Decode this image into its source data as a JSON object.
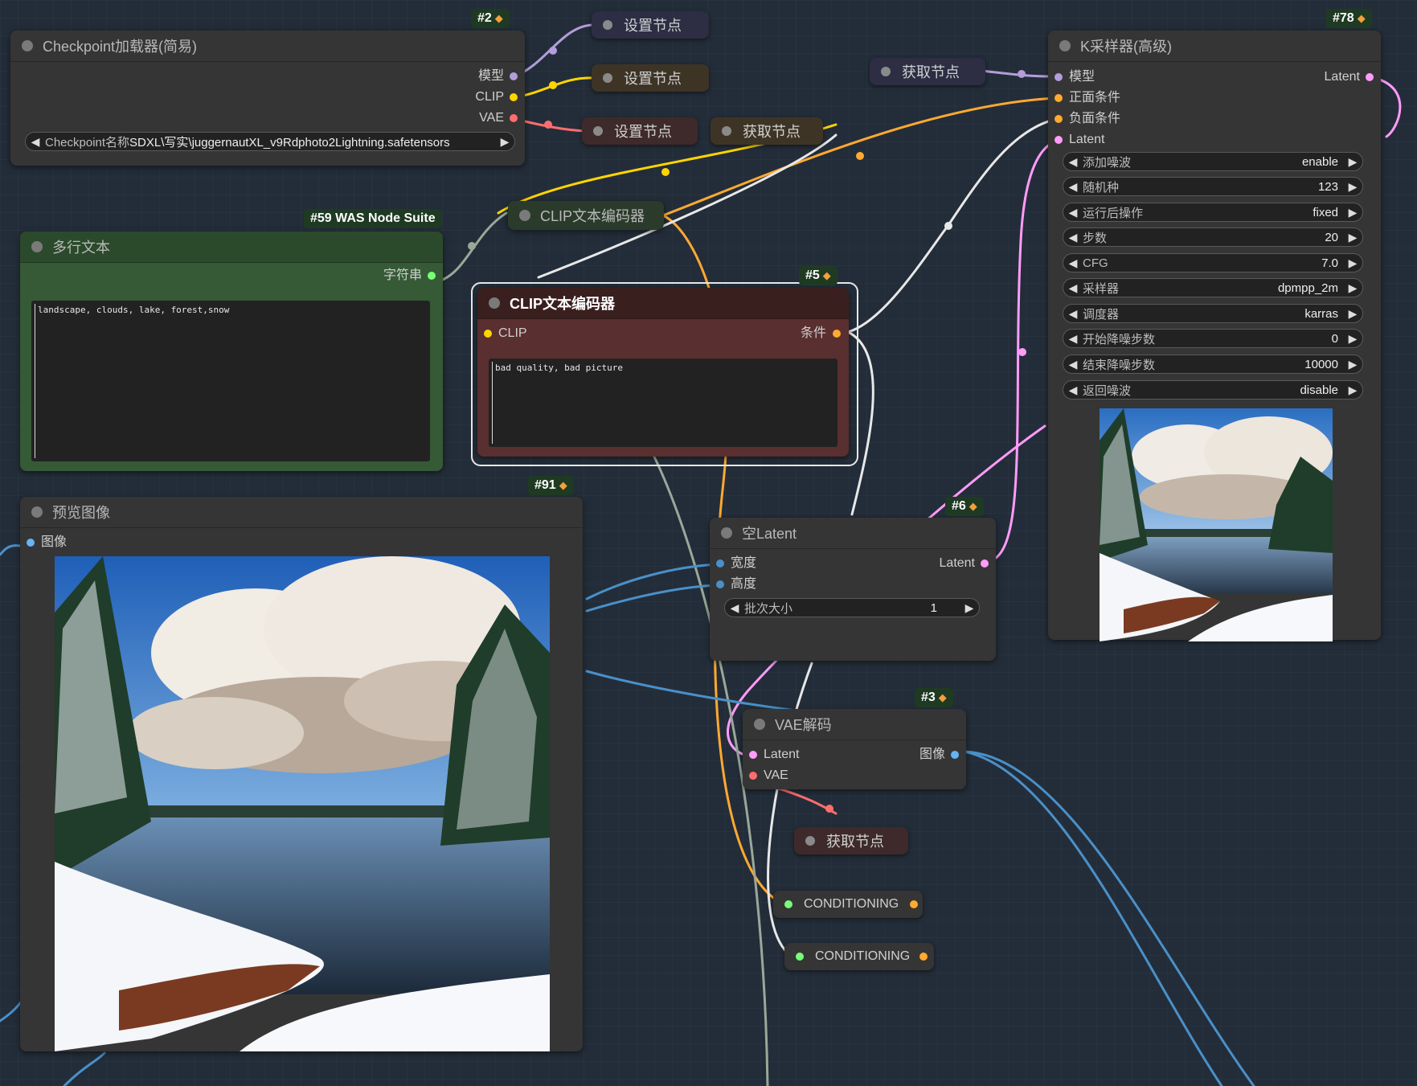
{
  "nodes": {
    "checkpoint": {
      "badge": "#2",
      "title": "Checkpoint加载器(简易)",
      "outputs": [
        "模型",
        "CLIP",
        "VAE"
      ],
      "widget_label": "Checkpoint名称",
      "widget_value": "SDXL\\写实\\juggernautXL_v9Rdphoto2Lightning.safetensors"
    },
    "multiline_text": {
      "badge": "#59 WAS Node Suite",
      "title": "多行文本",
      "output": "字符串",
      "text": "landscape, clouds, lake, forest,snow"
    },
    "clip_encoder_positive": {
      "title": "CLIP文本编码器"
    },
    "clip_encoder_negative": {
      "badge": "#5",
      "title": "CLIP文本编码器",
      "input": "CLIP",
      "output": "条件",
      "text": "bad quality, bad picture"
    },
    "ksampler": {
      "badge": "#78",
      "title": "K采样器(高级)",
      "inputs": [
        "模型",
        "正面条件",
        "负面条件",
        "Latent"
      ],
      "output": "Latent",
      "widgets": [
        {
          "label": "添加噪波",
          "value": "enable"
        },
        {
          "label": "随机种",
          "value": "123"
        },
        {
          "label": "运行后操作",
          "value": "fixed"
        },
        {
          "label": "步数",
          "value": "20"
        },
        {
          "label": "CFG",
          "value": "7.0"
        },
        {
          "label": "采样器",
          "value": "dpmpp_2m"
        },
        {
          "label": "调度器",
          "value": "karras"
        },
        {
          "label": "开始降噪步数",
          "value": "0"
        },
        {
          "label": "结束降噪步数",
          "value": "10000"
        },
        {
          "label": "返回噪波",
          "value": "disable"
        }
      ]
    },
    "preview": {
      "badge": "#91",
      "title": "预览图像",
      "input": "图像"
    },
    "empty_latent": {
      "badge": "#6",
      "title": "空Latent",
      "inputs": [
        "宽度",
        "高度"
      ],
      "output": "Latent",
      "widget_label": "批次大小",
      "widget_value": "1"
    },
    "vae_decode": {
      "badge": "#3",
      "title": "VAE解码",
      "inputs": [
        "Latent",
        "VAE"
      ],
      "output": "图像"
    }
  },
  "reroutes": {
    "set1": "设置节点",
    "set2": "设置节点",
    "set3": "设置节点",
    "get1": "获取节点",
    "get2": "获取节点",
    "get3": "获取节点",
    "cond1": "CONDITIONING",
    "cond2": "CONDITIONING"
  },
  "colors": {
    "model": "#b39ddb",
    "clip": "#ffd500",
    "vae": "#ff6e6e",
    "conditioning": "#ffa931",
    "latent": "#ff9cf9",
    "image": "#64b5f6",
    "string": "#77ff77",
    "int": "#4a90c8"
  },
  "icons": {
    "fox_badge": "fox-icon",
    "arrow_left": "arrow-left-icon",
    "arrow_right": "arrow-right-icon"
  }
}
